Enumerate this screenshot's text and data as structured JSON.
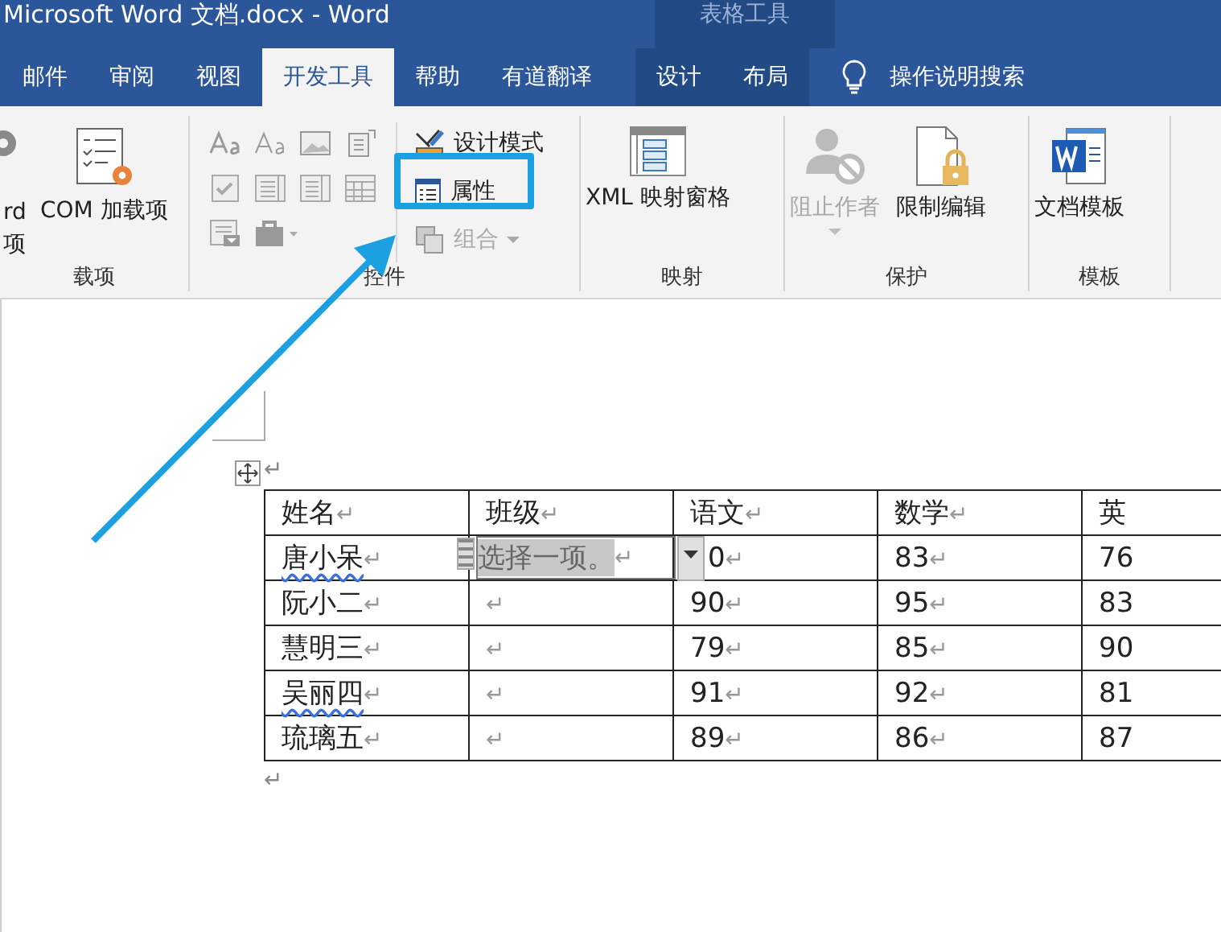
{
  "window": {
    "title": "Microsoft Word 文档.docx  -  Word",
    "context_group": "表格工具"
  },
  "tabs": [
    {
      "label": "邮件",
      "selected": false,
      "contextual": false
    },
    {
      "label": "审阅",
      "selected": false,
      "contextual": false
    },
    {
      "label": "视图",
      "selected": false,
      "contextual": false
    },
    {
      "label": "开发工具",
      "selected": true,
      "contextual": false
    },
    {
      "label": "帮助",
      "selected": false,
      "contextual": false
    },
    {
      "label": "有道翻译",
      "selected": false,
      "contextual": false
    },
    {
      "label": "设计",
      "selected": false,
      "contextual": true
    },
    {
      "label": "布局",
      "selected": false,
      "contextual": true
    }
  ],
  "tell_me": "操作说明搜索",
  "ribbon": {
    "addins": {
      "word_addins_lines": [
        "rd",
        "项"
      ],
      "com_addins": "COM 加载项",
      "label": "载项"
    },
    "controls": {
      "design_mode": {
        "label": "设计模式",
        "disabled": false
      },
      "properties": {
        "label": "属性",
        "disabled": false,
        "highlighted": true
      },
      "group": {
        "label": "组合",
        "disabled": true
      },
      "label": "控件"
    },
    "mapping": {
      "xml_pane": "XML 映射窗格",
      "label": "映射"
    },
    "protect": {
      "block_authors": {
        "label": "阻止作者",
        "disabled": true
      },
      "restrict_editing": {
        "label": "限制编辑",
        "disabled": false
      },
      "label": "保护"
    },
    "templates": {
      "document_template": "文档模板",
      "label": "模板"
    }
  },
  "annotation": {
    "arrow": true
  },
  "document": {
    "mark_above": "↵",
    "mark_below": "↵",
    "table": {
      "header": [
        {
          "text": "姓名",
          "mark": "↵"
        },
        {
          "text": "班级",
          "mark": "↵"
        },
        {
          "text": "语文",
          "mark": "↵"
        },
        {
          "text": "数学",
          "mark": "↵"
        },
        {
          "text": "英"
        }
      ],
      "rows": [
        {
          "cells": [
            {
              "text": "唐小呆",
              "mark": "↵",
              "spell_error": true
            },
            {
              "text": "",
              "dropdown": {
                "text": "选择一项。",
                "mark": "↵"
              }
            },
            {
              "text": "0",
              "mark": "↵"
            },
            {
              "text": "83",
              "mark": "↵"
            },
            {
              "text": "76"
            }
          ]
        },
        {
          "cells": [
            {
              "text": "阮小二",
              "mark": "↵",
              "spell_error": false
            },
            {
              "text": "",
              "mark": "↵"
            },
            {
              "text": "90",
              "mark": "↵"
            },
            {
              "text": "95",
              "mark": "↵"
            },
            {
              "text": "83"
            }
          ]
        },
        {
          "cells": [
            {
              "text": "慧明三",
              "mark": "↵",
              "spell_error": false
            },
            {
              "text": "",
              "mark": "↵"
            },
            {
              "text": "79",
              "mark": "↵"
            },
            {
              "text": "85",
              "mark": "↵"
            },
            {
              "text": "90"
            }
          ]
        },
        {
          "cells": [
            {
              "text": "吴丽四",
              "mark": "↵",
              "spell_error": true
            },
            {
              "text": "",
              "mark": "↵"
            },
            {
              "text": "91",
              "mark": "↵"
            },
            {
              "text": "92",
              "mark": "↵"
            },
            {
              "text": "81"
            }
          ]
        },
        {
          "cells": [
            {
              "text": "琉璃五",
              "mark": "↵",
              "spell_error": false
            },
            {
              "text": "",
              "mark": "↵"
            },
            {
              "text": "89",
              "mark": "↵"
            },
            {
              "text": "86",
              "mark": "↵"
            },
            {
              "text": "87"
            }
          ]
        }
      ]
    }
  }
}
